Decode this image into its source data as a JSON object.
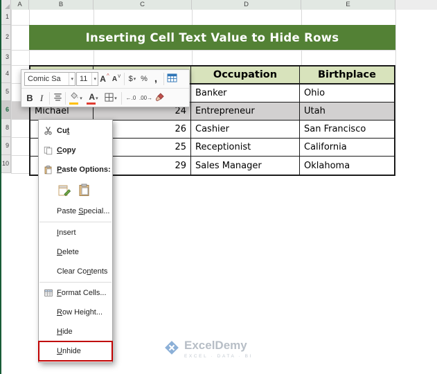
{
  "sheet": {
    "column_headers": [
      "A",
      "B",
      "C",
      "D",
      "E"
    ],
    "row_headers": [
      "1",
      "2",
      "3",
      "4",
      "5",
      "6",
      "8",
      "9",
      "10"
    ],
    "banner_title": "Inserting Cell Text Value to Hide Rows",
    "table": {
      "headers": [
        "",
        "",
        "Occupation",
        "Birthplace"
      ],
      "rows": [
        [
          "",
          "",
          "Banker",
          "Ohio"
        ],
        [
          "Michael",
          "24",
          "Entrepreneur",
          "Utah"
        ],
        [
          "",
          "26",
          "Cashier",
          "San Francisco"
        ],
        [
          "",
          "25",
          "Receptionist",
          "California"
        ],
        [
          "",
          "29",
          "Sales Manager",
          "Oklahoma"
        ]
      ]
    }
  },
  "mini_toolbar": {
    "font_name": "Comic Sa",
    "font_size": "11",
    "arrow": "▾",
    "grow_font": "A",
    "shrink_font": "A",
    "caret_up": "^",
    "caret_down": "v",
    "accounting": "$",
    "percent": "%",
    "comma": ",",
    "bold": "B",
    "italic": "I",
    "font_color_letter": "A",
    "increase_decimal": "←.0",
    "decrease_decimal": ".00→"
  },
  "context_menu": {
    "items": [
      {
        "pre": "Cu",
        "accel": "t",
        "post": ""
      },
      {
        "pre": "",
        "accel": "C",
        "post": "opy"
      },
      {
        "pre": "",
        "accel": "P",
        "post": "aste Options:"
      },
      {
        "pre": "Paste ",
        "accel": "S",
        "post": "pecial..."
      },
      {
        "pre": "",
        "accel": "I",
        "post": "nsert"
      },
      {
        "pre": "",
        "accel": "D",
        "post": "elete"
      },
      {
        "pre": "Clear Co",
        "accel": "n",
        "post": "tents"
      },
      {
        "pre": "",
        "accel": "F",
        "post": "ormat Cells..."
      },
      {
        "pre": "",
        "accel": "R",
        "post": "ow Height..."
      },
      {
        "pre": "",
        "accel": "H",
        "post": "ide"
      },
      {
        "pre": "",
        "accel": "U",
        "post": "nhide"
      }
    ]
  },
  "watermark": {
    "brand": "ExcelDemy",
    "tagline": "EXCEL · DATA · BI"
  },
  "colors": {
    "excel_green": "#217346",
    "banner_green": "#538135",
    "table_header_fill": "#D8E3BC",
    "selection_gray": "#D2D0D0",
    "highlight_red": "#C00000"
  }
}
